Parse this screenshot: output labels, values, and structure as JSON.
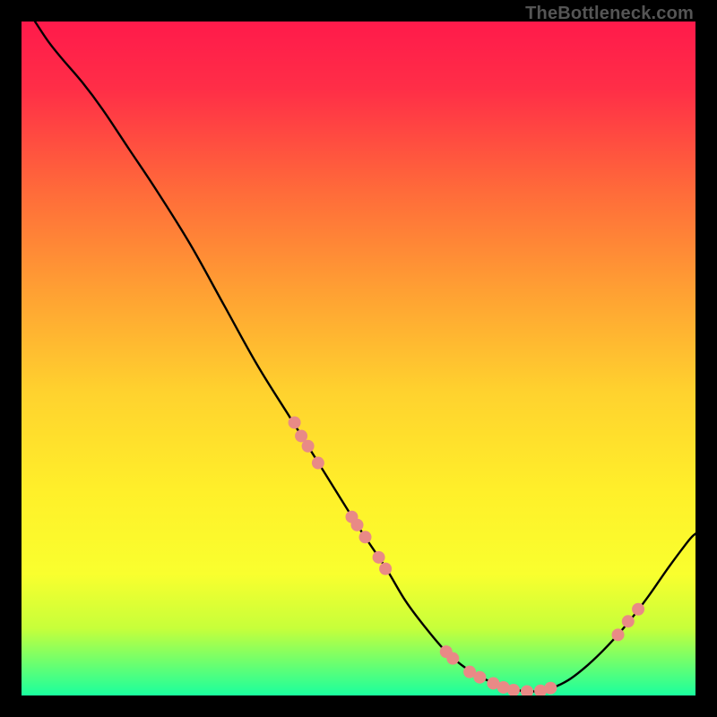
{
  "watermark": "TheBottleneck.com",
  "chart_data": {
    "type": "line",
    "title": "",
    "xlabel": "",
    "ylabel": "",
    "xlim": [
      0,
      100
    ],
    "ylim": [
      0,
      100
    ],
    "background_gradient": {
      "stops": [
        {
          "offset": 0.0,
          "color": "#ff1a4b"
        },
        {
          "offset": 0.1,
          "color": "#ff2e47"
        },
        {
          "offset": 0.25,
          "color": "#ff6a3a"
        },
        {
          "offset": 0.4,
          "color": "#ffa033"
        },
        {
          "offset": 0.55,
          "color": "#ffd22e"
        },
        {
          "offset": 0.7,
          "color": "#fff02a"
        },
        {
          "offset": 0.82,
          "color": "#f9ff2e"
        },
        {
          "offset": 0.9,
          "color": "#c7ff3a"
        },
        {
          "offset": 0.96,
          "color": "#5eff77"
        },
        {
          "offset": 1.0,
          "color": "#1aff9e"
        }
      ]
    },
    "series": [
      {
        "name": "bottleneck-curve",
        "color": "#000000",
        "x": [
          2,
          4,
          6,
          9,
          12,
          16,
          20,
          25,
          30,
          35,
          40,
          45,
          50,
          54,
          57,
          60,
          63,
          66,
          69,
          72,
          75,
          78,
          81,
          84,
          87,
          90,
          93,
          96,
          99,
          100
        ],
        "y": [
          100,
          97,
          94.5,
          91,
          87,
          81,
          75,
          67,
          58,
          49,
          41,
          33,
          25,
          19,
          14,
          10,
          6.5,
          4,
          2.3,
          1.2,
          0.6,
          0.9,
          2.2,
          4.5,
          7.4,
          10.8,
          14.7,
          19.0,
          23.0,
          24.0
        ]
      }
    ],
    "markers": {
      "name": "sample-points",
      "color": "#e98a86",
      "radius": 7,
      "points": [
        {
          "x": 40.5,
          "y": 40.5
        },
        {
          "x": 41.5,
          "y": 38.5
        },
        {
          "x": 42.5,
          "y": 37.0
        },
        {
          "x": 44.0,
          "y": 34.5
        },
        {
          "x": 49.0,
          "y": 26.5
        },
        {
          "x": 49.8,
          "y": 25.3
        },
        {
          "x": 51.0,
          "y": 23.5
        },
        {
          "x": 53.0,
          "y": 20.5
        },
        {
          "x": 54.0,
          "y": 18.8
        },
        {
          "x": 63.0,
          "y": 6.5
        },
        {
          "x": 64.0,
          "y": 5.5
        },
        {
          "x": 66.5,
          "y": 3.5
        },
        {
          "x": 68.0,
          "y": 2.7
        },
        {
          "x": 70.0,
          "y": 1.8
        },
        {
          "x": 71.5,
          "y": 1.2
        },
        {
          "x": 73.0,
          "y": 0.8
        },
        {
          "x": 75.0,
          "y": 0.6
        },
        {
          "x": 77.0,
          "y": 0.7
        },
        {
          "x": 78.5,
          "y": 1.1
        },
        {
          "x": 88.5,
          "y": 9.0
        },
        {
          "x": 90.0,
          "y": 11.0
        },
        {
          "x": 91.5,
          "y": 12.8
        }
      ]
    }
  }
}
